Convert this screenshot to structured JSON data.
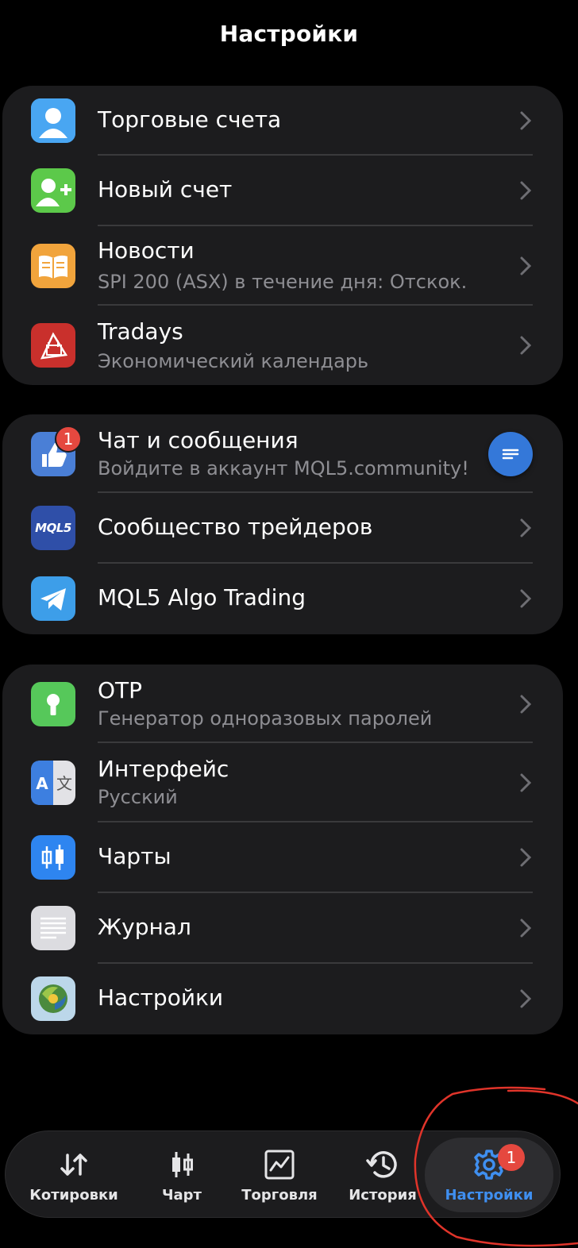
{
  "header": {
    "title": "Настройки"
  },
  "groups": {
    "g1": {
      "trading_accounts": {
        "label": "Торговые счета"
      },
      "new_account": {
        "label": "Новый счет"
      },
      "news": {
        "label": "Новости",
        "subtitle": "SPI 200 (ASX) в течение дня: Отскок."
      },
      "tradays": {
        "label": "Tradays",
        "subtitle": "Экономический календарь"
      }
    },
    "g2": {
      "chat": {
        "label": "Чат и сообщения",
        "subtitle": "Войдите в аккаунт MQL5.community!",
        "badge": "1"
      },
      "community": {
        "label": "Сообщество трейдеров",
        "icon_text": "MQL5"
      },
      "algo": {
        "label": "MQL5 Algo Trading"
      }
    },
    "g3": {
      "otp": {
        "label": "OTP",
        "subtitle": "Генератор одноразовых паролей"
      },
      "interface": {
        "label": "Интерфейс",
        "subtitle": "Русский"
      },
      "charts": {
        "label": "Чарты"
      },
      "journal": {
        "label": "Журнал"
      },
      "settings": {
        "label": "Настройки"
      }
    }
  },
  "tabbar": {
    "quotes": "Котировки",
    "chart": "Чарт",
    "trade": "Торговля",
    "history": "История",
    "settings": "Настройки",
    "settings_badge": "1"
  },
  "colors": {
    "accent": "#3f8ff0",
    "badge": "#e5483f",
    "group_bg": "#1c1c1e",
    "annotation": "#e0342a"
  },
  "icons": {
    "trading_accounts": "person-icon",
    "new_account": "person-add-icon",
    "news": "book-icon",
    "tradays": "calendar-icon",
    "chat": "thumbs-up-icon",
    "community": "mql5-logo-icon",
    "algo": "telegram-icon",
    "otp": "keyhole-icon",
    "interface": "translate-icon",
    "charts": "candlestick-icon",
    "journal": "journal-lines-icon",
    "settings": "metatrader-icon"
  }
}
